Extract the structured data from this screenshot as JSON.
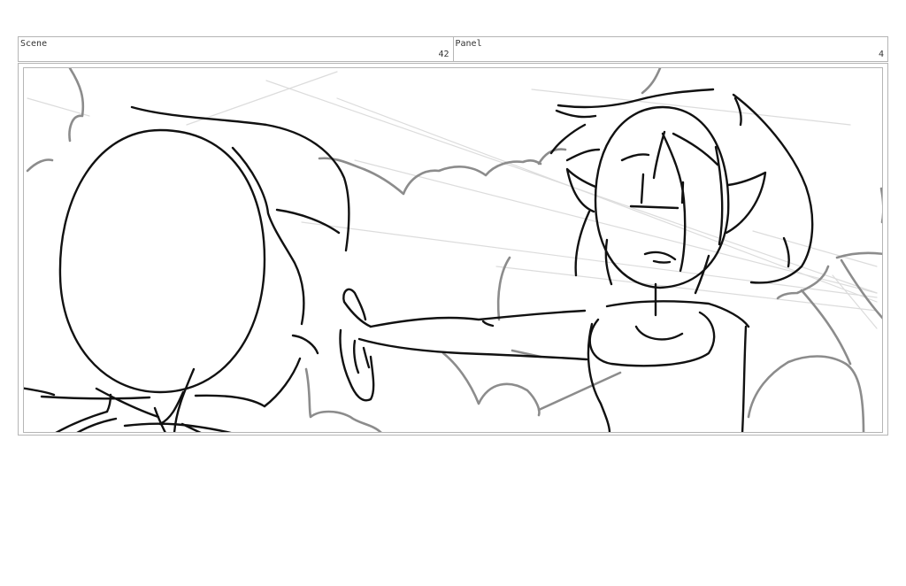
{
  "header": {
    "scene_label": "Scene",
    "scene_number": "42",
    "panel_label": "Panel",
    "panel_number": "4"
  },
  "drawing": {
    "style": "pencil storyboard sketch",
    "stroke_color": "#111111",
    "background_stroke_color": "#8c8c8c",
    "guide_stroke_color": "#dddddd"
  }
}
